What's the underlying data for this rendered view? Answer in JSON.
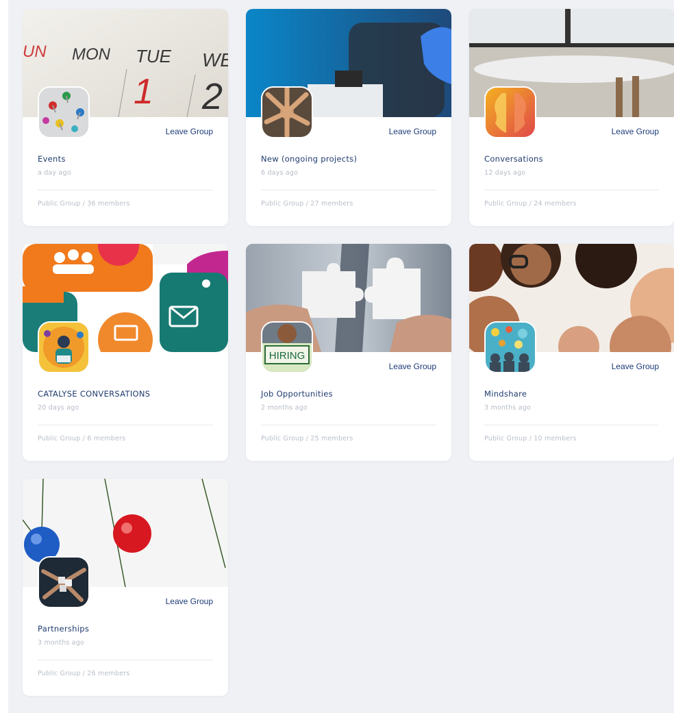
{
  "groups": [
    {
      "name": "Events",
      "time": "a day ago",
      "meta": "Public Group / 36 members",
      "action": "Leave Group",
      "cover": "calendar-cover",
      "avatar": "pushpins-avatar"
    },
    {
      "name": "New (ongoing projects)",
      "time": "6 days ago",
      "meta": "Public Group / 27 members",
      "action": "Leave Group",
      "cover": "lab-microscope-cover",
      "avatar": "team-hands-avatar"
    },
    {
      "name": "Conversations",
      "time": "12 days ago",
      "meta": "Public Group / 24 members",
      "action": "Leave Group",
      "cover": "table-window-cover",
      "avatar": "face-profiles-avatar"
    },
    {
      "name": "CATALYSE CONVERSATIONS",
      "time": "20 days ago",
      "meta": "Public Group / 6 members",
      "action": "",
      "cover": "social-icons-cover",
      "avatar": "person-laptop-avatar"
    },
    {
      "name": "Job Opportunities",
      "time": "2 months ago",
      "meta": "Public Group / 25 members",
      "action": "Leave Group",
      "cover": "puzzle-pieces-cover",
      "avatar": "hiring-sign-avatar",
      "avatar_text": "HIRING"
    },
    {
      "name": "Mindshare",
      "time": "3 months ago",
      "meta": "Public Group / 10 members",
      "action": "Leave Group",
      "cover": "people-circle-cover",
      "avatar": "ideas-avatar"
    },
    {
      "name": "Partnerships",
      "time": "3 months ago",
      "meta": "Public Group / 26 members",
      "action": "Leave Group",
      "cover": "pins-string-cover",
      "avatar": "puzzle-hands-avatar"
    }
  ],
  "colors": {
    "page_bg": "#eff1f5",
    "card_bg": "#ffffff",
    "link": "#1b3a78",
    "title": "#1f3b6e",
    "muted": "#b5bcc6"
  }
}
